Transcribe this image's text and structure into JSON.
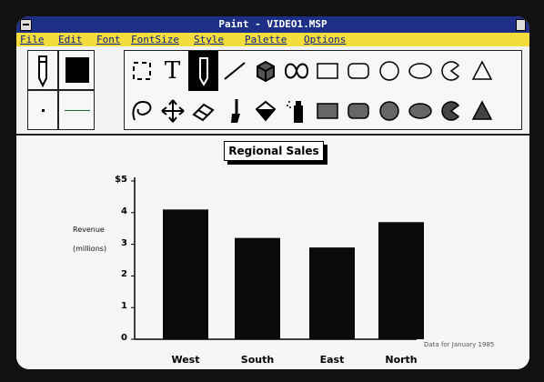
{
  "window": {
    "title": "Paint - VIDEO1.MSP"
  },
  "menu": [
    "File",
    "Edit",
    "Font",
    "FontSize",
    "Style",
    "Palette",
    "Options"
  ],
  "tools": {
    "row1": [
      "selection-rect-icon",
      "text-tool-icon",
      "pencil-icon",
      "line-icon",
      "cube-icon",
      "curve-icon",
      "rectangle-icon",
      "rounded-rect-icon",
      "circle-icon",
      "ellipse-icon",
      "pie-icon",
      "triangle-icon"
    ],
    "row2": [
      "lasso-icon",
      "move-icon",
      "eraser-icon",
      "brush-icon",
      "paint-bucket-icon",
      "spray-can-icon",
      "filled-rectangle-icon",
      "filled-rounded-rect-icon",
      "filled-circle-icon",
      "filled-ellipse-icon",
      "filled-pie-icon",
      "filled-triangle-icon"
    ],
    "text_glyph": "T"
  },
  "chart_data": {
    "type": "bar",
    "title": "Regional Sales",
    "ylabel_lines": [
      "Revenue",
      "(millions)"
    ],
    "categories": [
      "West",
      "South",
      "East",
      "North"
    ],
    "values": [
      4.1,
      3.2,
      2.9,
      3.7
    ],
    "ylim": [
      0,
      5
    ],
    "y_ticks": [
      "0",
      "1",
      "2",
      "3",
      "4",
      "$5"
    ],
    "bar_color": "#0a0a0a",
    "footnote": "Data for January 1985"
  },
  "colors": {
    "title_bar": "#1d2f86",
    "menu_bar": "#f2dd3c",
    "menu_text": "#0a1d8a"
  }
}
